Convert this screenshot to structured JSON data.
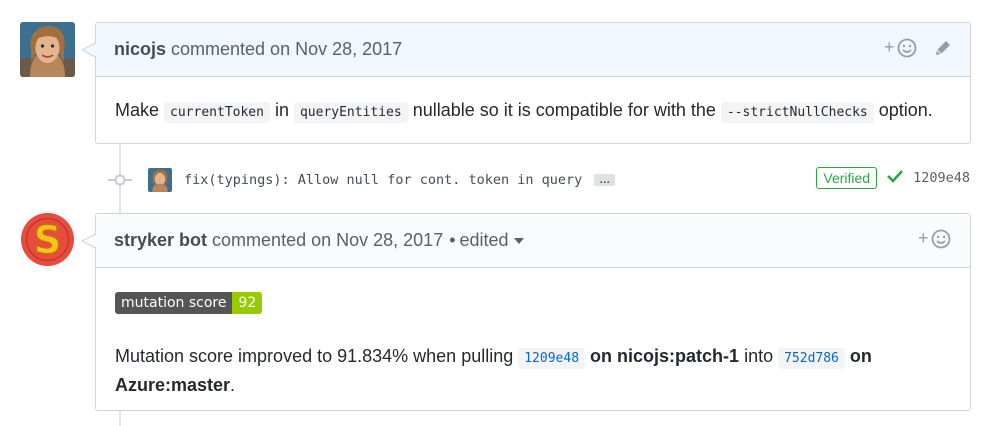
{
  "comment1": {
    "author": "nicojs",
    "action": "commented on",
    "date": "Nov 28, 2017",
    "reaction_icon": "smiley-plus-icon",
    "edit_icon": "pencil-icon",
    "body": {
      "t1": "Make ",
      "code1": "currentToken",
      "t2": " in ",
      "code2": "queryEntities",
      "t3": " nullable so it is compatible for with the ",
      "code3": "--strictNullChecks",
      "t4": " option."
    }
  },
  "commit": {
    "message": "fix(typings): Allow null for cont. token in query",
    "expand_label": "…",
    "verified_label": "Verified",
    "sha": "1209e48",
    "status_icon": "check-icon",
    "colors": {
      "verified": "#28a745"
    }
  },
  "comment2": {
    "author": "stryker bot",
    "action": "commented on",
    "date": "Nov 28, 2017",
    "separator": "•",
    "edited": "edited",
    "reaction_icon": "smiley-plus-icon",
    "badge": {
      "label": "mutation score",
      "value": "92",
      "colors": {
        "label_bg": "#555555",
        "value_bg": "#97ca00"
      }
    },
    "body": {
      "t1": "Mutation score improved to 91.834% when pulling ",
      "sha1": "1209e48",
      "t2": " ",
      "branch1": "on nicojs:patch-1",
      "t3": " into ",
      "sha2": "752d786",
      "t4": " ",
      "branch2_a": "on",
      "branch2_b": "Azure:master",
      "t5": "."
    }
  },
  "colors": {
    "header_bg_own": "#f1f8ff",
    "header_bg": "#fafbfc",
    "border": "#d1d5da",
    "link": "#0366d6"
  }
}
